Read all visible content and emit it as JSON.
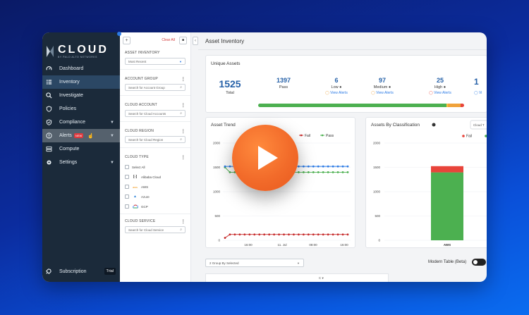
{
  "brand": {
    "name": "CLOUD",
    "sub": "BY PALO ALTO NETWORKS"
  },
  "sidebar": {
    "items": [
      {
        "label": "Dashboard",
        "icon": "gauge-icon"
      },
      {
        "label": "Inventory",
        "icon": "list-icon",
        "active": true
      },
      {
        "label": "Investigate",
        "icon": "search-icon"
      },
      {
        "label": "Policies",
        "icon": "shield-icon"
      },
      {
        "label": "Compliance",
        "icon": "check-shield-icon",
        "chevron": true
      },
      {
        "label": "Alerts",
        "icon": "alert-icon",
        "badge": "NEW",
        "chevron": true
      },
      {
        "label": "Compute",
        "icon": "server-icon"
      },
      {
        "label": "Settings",
        "icon": "gear-icon",
        "chevron": true
      }
    ],
    "footer": {
      "label": "Subscription",
      "badge": "Trial"
    }
  },
  "filters": {
    "clear_all": "Clear All",
    "asset_inventory": {
      "title": "ASSET INVENTORY",
      "selected": "Most Recent"
    },
    "account_group": {
      "title": "ACCOUNT GROUP",
      "placeholder": "Search for Account Group"
    },
    "cloud_account": {
      "title": "CLOUD ACCOUNT",
      "placeholder": "Search for Cloud Accounts"
    },
    "cloud_region": {
      "title": "CLOUD REGION",
      "placeholder": "Search for Cloud Region"
    },
    "cloud_type": {
      "title": "CLOUD TYPE",
      "options": [
        "Select All",
        "Alibaba Cloud",
        "AWS",
        "Azure",
        "GCP"
      ]
    },
    "cloud_service": {
      "title": "CLOUD SERVICE",
      "placeholder": "Search for Cloud Service"
    }
  },
  "main": {
    "title": "Asset Inventory",
    "unique_assets": {
      "title": "Unique Assets",
      "total": {
        "value": "1525",
        "label": "Total"
      },
      "pass": {
        "value": "1397",
        "label": "Pass"
      },
      "low": {
        "value": "6",
        "label": "Low",
        "link": "View Alerts"
      },
      "medium": {
        "value": "97",
        "label": "Medium",
        "link": "View Alerts"
      },
      "high": {
        "value": "25",
        "label": "High",
        "link": "View Alerts"
      },
      "extra": {
        "value": "1",
        "link": "Vi"
      },
      "bar_fractions": {
        "pass": 0.916,
        "low": 0.004,
        "medium": 0.064,
        "high": 0.016
      },
      "colors": {
        "pass": "#4cb050",
        "low": "#f6c343",
        "medium": "#f0a23a",
        "high": "#e8443a"
      }
    },
    "group_by": "2 Group By Selected",
    "modern_table": "Modern Table (Beta)",
    "table_col": "C"
  },
  "chart_data": [
    {
      "type": "line",
      "title": "Asset Trend",
      "legend": [
        "Fail",
        "Pass"
      ],
      "x_ticks": [
        "16:00",
        "11. Jul",
        "08:00",
        "16:00"
      ],
      "y_ticks": [
        "2000",
        "1500",
        "1000",
        "500",
        "0"
      ],
      "ylim": [
        0,
        2000
      ],
      "series": [
        {
          "name": "Fail",
          "color": "#c62828",
          "values": [
            50,
            120,
            120,
            120,
            120,
            120,
            120,
            120,
            120,
            120,
            120,
            120,
            120,
            120,
            120,
            120,
            120,
            120,
            120,
            120,
            120,
            120,
            120,
            120,
            120,
            120
          ]
        },
        {
          "name": "Pass",
          "color": "#4cb050",
          "values": [
            1500,
            1400,
            1400,
            1400,
            1400,
            1400,
            1400,
            1400,
            1400,
            1400,
            1400,
            1400,
            1400,
            1400,
            1400,
            1400,
            1400,
            1400,
            1400,
            1400,
            1400,
            1400,
            1400,
            1400,
            1400,
            1400
          ]
        },
        {
          "name": "Total",
          "color": "#2c7be5",
          "values": [
            1520,
            1520,
            1520,
            1520,
            1520,
            1520,
            1520,
            1520,
            1520,
            1520,
            1520,
            1520,
            1520,
            1520,
            1520,
            1520,
            1520,
            1520,
            1520,
            1520,
            1520,
            1520,
            1520,
            1520,
            1520,
            1520
          ]
        }
      ]
    },
    {
      "type": "bar",
      "title": "Assets By Classification",
      "dropdown": "Cloud T",
      "legend": [
        "Fail"
      ],
      "categories": [
        "AWS"
      ],
      "y_ticks": [
        "2000",
        "1500",
        "1000",
        "500",
        "0"
      ],
      "ylim": [
        0,
        2000
      ],
      "series": [
        {
          "name": "Pass",
          "color": "#4cb050",
          "values": [
            1397
          ]
        },
        {
          "name": "Fail",
          "color": "#e8443a",
          "values": [
            128
          ]
        }
      ]
    }
  ]
}
